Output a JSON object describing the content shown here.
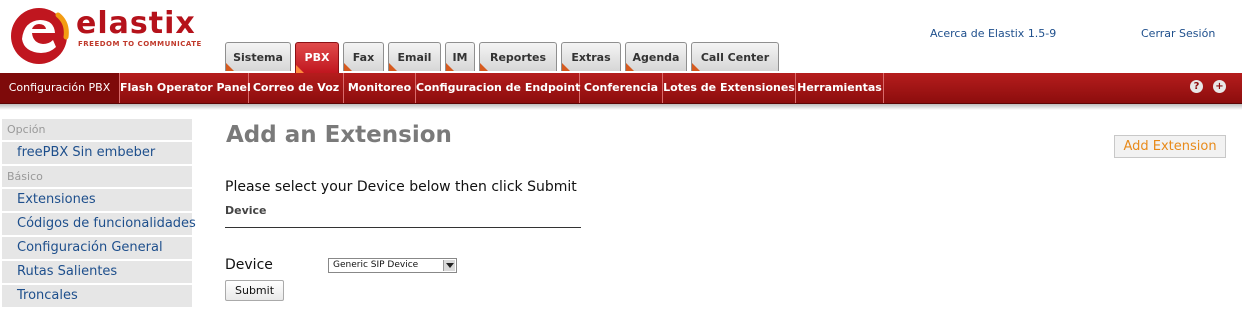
{
  "header": {
    "logo_text": "elastix",
    "logo_tagline": "FREEDOM TO COMMUNICATE",
    "about_link": "Acerca de Elastix 1.5-9",
    "logout_link": "Cerrar Sesión"
  },
  "tabs": [
    {
      "label": "Sistema"
    },
    {
      "label": "PBX"
    },
    {
      "label": "Fax"
    },
    {
      "label": "Email"
    },
    {
      "label": "IM"
    },
    {
      "label": "Reportes"
    },
    {
      "label": "Extras"
    },
    {
      "label": "Agenda"
    },
    {
      "label": "Call Center"
    }
  ],
  "active_tab": "PBX",
  "nav": {
    "items": [
      {
        "label": "Configuración PBX"
      },
      {
        "label": "Flash Operator Panel"
      },
      {
        "label": "Correo de Voz"
      },
      {
        "label": "Monitoreo"
      },
      {
        "label": "Configuracion de Endpoint"
      },
      {
        "label": "Conferencia"
      },
      {
        "label": "Lotes de Extensiones"
      },
      {
        "label": "Herramientas"
      }
    ],
    "active_item": "Configuración PBX",
    "help_icon": "question-icon",
    "add_icon": "plus-icon"
  },
  "sidebar": {
    "section1_title": "Opción",
    "section1_items": [
      "freePBX Sin embeber"
    ],
    "section2_title": "Básico",
    "section2_items": [
      "Extensiones",
      "Códigos de funcionalidades",
      "Configuración General",
      "Rutas Salientes",
      "Troncales"
    ]
  },
  "main": {
    "title": "Add an Extension",
    "add_button": "Add Extension",
    "instruction": "Please select your Device below then click Submit",
    "device_section": "Device",
    "device_label": "Device",
    "device_selected": "Generic SIP Device",
    "submit_label": "Submit"
  },
  "colors": {
    "brand_red": "#b5121b",
    "nav_red": "#8c0d0d",
    "link_blue": "#1e4f8c",
    "accent_orange": "#e88a1a"
  }
}
